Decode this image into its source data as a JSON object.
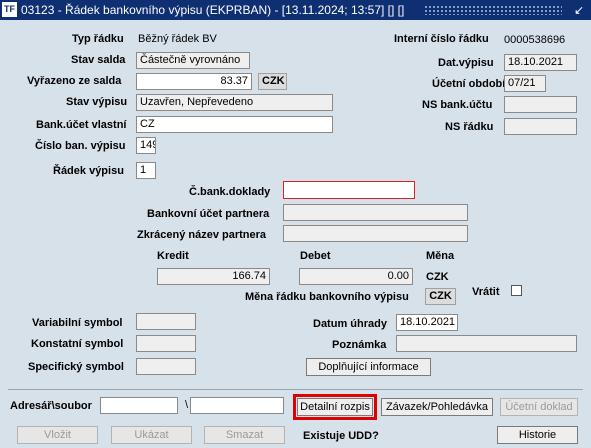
{
  "window": {
    "title": "03123 - Řádek bankovního výpisu (EKPRBAN) - [13.11.2024; 13:57] [] []",
    "app_icon_text": "TF",
    "minimize_icon": "↙"
  },
  "left": {
    "typ_radku_label": "Typ řádku",
    "typ_radku_value": "Běžný řádek BV",
    "stav_salda_label": "Stav salda",
    "stav_salda_value": "Částečně vyrovnáno",
    "vyrazeno_label": "Vyřazeno ze salda",
    "vyrazeno_value": "83.37",
    "vyrazeno_currency": "CZK",
    "stav_vypisu_label": "Stav výpisu",
    "stav_vypisu_value": "Uzavřen, Nepřevedeno",
    "bank_ucet_label": "Bank.účet vlastní",
    "bank_ucet_value": "CZ",
    "cislo_ban_label": "Číslo ban. výpisu",
    "cislo_ban_value": "149",
    "radek_vypisu_label": "Řádek výpisu",
    "radek_vypisu_value": "1"
  },
  "right": {
    "interni_cislo_label": "Interní číslo řádku",
    "interni_cislo_value": "0000538696",
    "dat_vypisu_label": "Dat.výpisu",
    "dat_vypisu_value": "18.10.2021",
    "ucetni_obdobi_label": "Účetní období",
    "ucetni_obdobi_value": "07/21",
    "ns_bank_label": "NS bank.účtu",
    "ns_bank_value": "",
    "ns_radku_label": "NS řádku",
    "ns_radku_value": ""
  },
  "partner": {
    "bank_doklad_label": "Č.bank.doklady",
    "bank_doklad_value": "",
    "ucet_partnera_label": "Bankovní účet partnera",
    "ucet_partnera_value": "",
    "nazev_partnera_label": "Zkrácený název partnera",
    "nazev_partnera_value": ""
  },
  "amounts": {
    "kredit_label": "Kredit",
    "kredit_value": "166.74",
    "debet_label": "Debet",
    "debet_value": "0.00",
    "mena_label": "Měna",
    "mena_value": "CZK",
    "mena_radku_label": "Měna řádku bankovního výpisu",
    "mena_radku_value": "CZK",
    "vratit_label": "Vrátit",
    "vratit_checked": false
  },
  "symbols": {
    "variabilni_label": "Variabilní symbol",
    "variabilni_value": "",
    "konstantni_label": "Konstatní symbol",
    "konstantni_value": "",
    "specificky_label": "Specifický symbol",
    "specificky_value": "",
    "datum_uhrady_label": "Datum úhrady",
    "datum_uhrady_value": "18.10.2021",
    "poznamka_label": "Poznámka",
    "poznamka_value": "",
    "doplnujici_button": "Doplňující informace"
  },
  "bottom": {
    "adresar_label": "Adresář\\soubor",
    "adresar_value": "",
    "separator": "\\",
    "soubor_value": "",
    "detailni_rozpis": "Detailní rozpis",
    "zavazek": "Závazek/Pohledávka",
    "ucetni_doklad": "Účetní doklad",
    "vlozit": "Vložit",
    "ukazat": "Ukázat",
    "smazat": "Smazat",
    "existuje_udd": "Existuje UDD?",
    "historie": "Historie"
  }
}
